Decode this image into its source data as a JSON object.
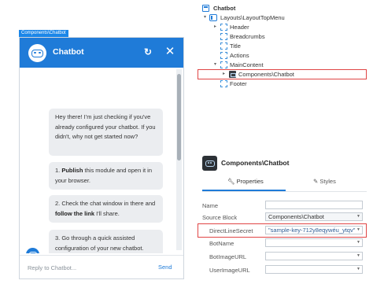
{
  "preview": {
    "component_tag": "Components\\Chatbot",
    "chat": {
      "title": "Chatbot",
      "refresh_icon": "refresh-icon",
      "close_icon": "close-icon",
      "messages": [
        {
          "parts": [
            "Hey there! I'm just checking if you've already configured your chatbot. If you didn't, why not get started now?"
          ]
        },
        {
          "parts": [
            "1. ",
            "Publish",
            " this module and open it in your browser."
          ]
        },
        {
          "parts": [
            "2. Check the chat window in there and ",
            "follow the link",
            " I'll share."
          ]
        },
        {
          "parts": [
            "3. Go through a quick assisted configuration of your new chatbot."
          ]
        },
        {
          "parts": [
            ""
          ]
        }
      ],
      "input_placeholder": "Reply to Chatbot...",
      "send_label": "Send"
    }
  },
  "tree": {
    "root": "Chatbot",
    "layout": "Layouts\\LayoutTopMenu",
    "items": [
      "Header",
      "Breadcrumbs",
      "Title",
      "Actions"
    ],
    "main_content": "MainContent",
    "selected": "Components\\Chatbot",
    "footer": "Footer"
  },
  "properties": {
    "title": "Components\\Chatbot",
    "tabs": {
      "properties": "Properties",
      "styles": "Styles"
    },
    "rows": [
      {
        "label": "Name",
        "value": "",
        "dropdown": false
      },
      {
        "label": "Source Block",
        "value": "Components\\Chatbot",
        "dropdown": true
      },
      {
        "label": "DirectLineSecret",
        "value": "\"sample-key-712y8eqywéu_ytqv\"",
        "dropdown": true
      },
      {
        "label": "BotName",
        "value": "",
        "dropdown": true
      },
      {
        "label": "BotImageURL",
        "value": "",
        "dropdown": true
      },
      {
        "label": "UserImageURL",
        "value": "",
        "dropdown": true
      }
    ]
  },
  "colors": {
    "accent": "#1f7bd8",
    "highlight": "#e04545"
  }
}
